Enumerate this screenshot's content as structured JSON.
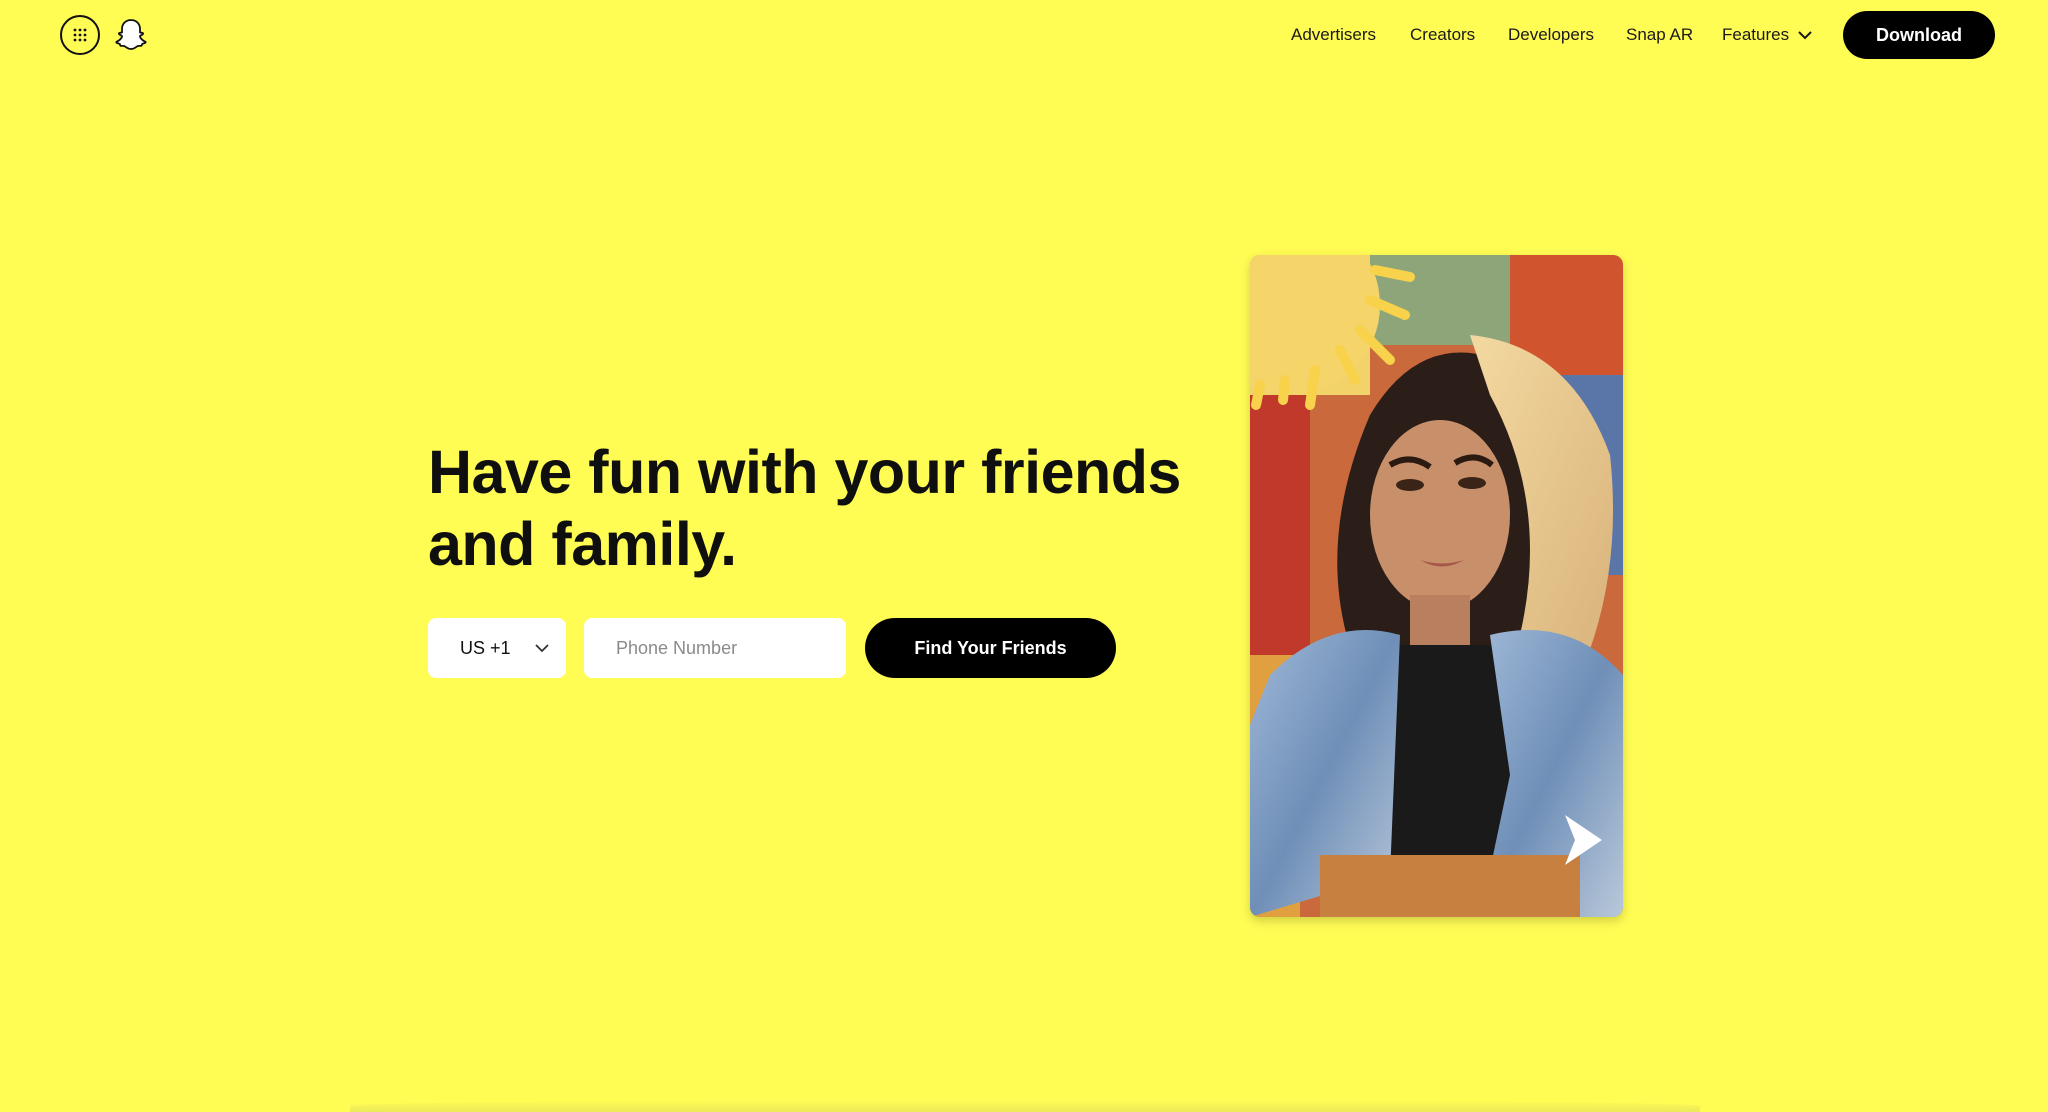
{
  "header": {
    "apps_icon": "grid-dots-icon",
    "logo_icon": "snapchat-ghost-icon",
    "nav": [
      {
        "label": "Advertisers"
      },
      {
        "label": "Creators"
      },
      {
        "label": "Developers"
      },
      {
        "label": "Snap AR"
      },
      {
        "label": "Features",
        "icon": "chevron-down-icon"
      }
    ],
    "download_label": "Download"
  },
  "hero": {
    "headline_line1": "Have fun with your friends",
    "headline_line2": "and family.",
    "country_code": "US +1",
    "phone_placeholder": "Phone Number",
    "find_button_label": "Find Your Friends"
  },
  "colors": {
    "background": "#FFFC54",
    "button": "#000000",
    "button_text": "#FFFFFF"
  }
}
